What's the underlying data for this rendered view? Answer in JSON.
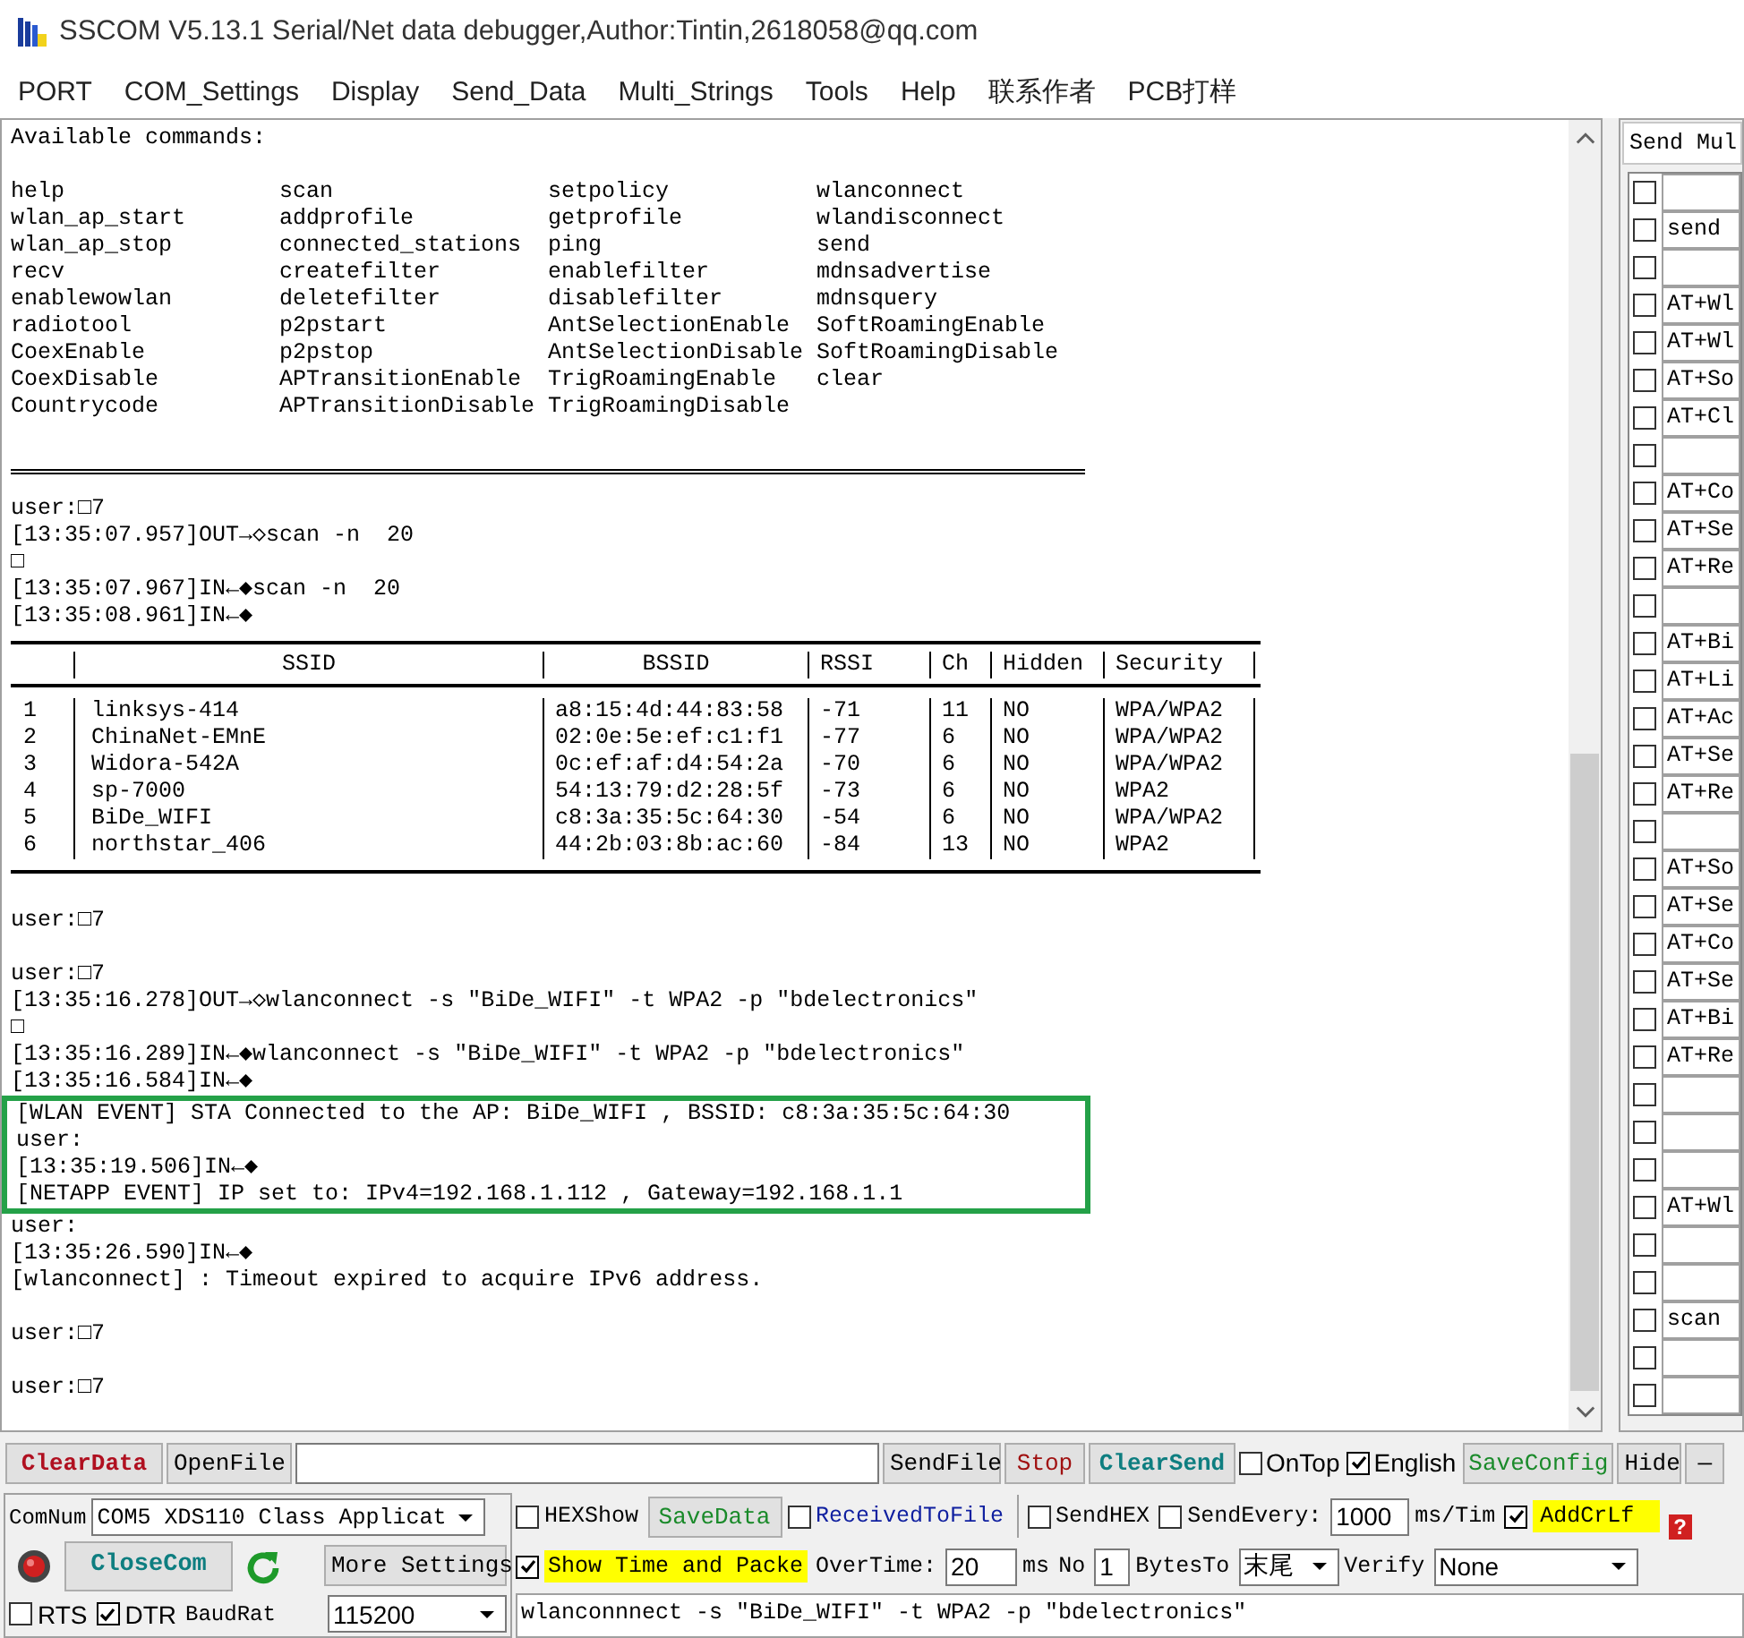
{
  "window": {
    "title": "SSCOM V5.13.1 Serial/Net data debugger,Author:Tintin,2618058@qq.com"
  },
  "menu": [
    "PORT",
    "COM_Settings",
    "Display",
    "Send_Data",
    "Multi_Strings",
    "Tools",
    "Help",
    "联系作者",
    "PCB打样"
  ],
  "terminal": {
    "blocks": [
      {
        "kind": "line",
        "text": "Available commands:"
      },
      {
        "kind": "blank"
      },
      {
        "kind": "commands",
        "rows": [
          [
            "help",
            "scan",
            "setpolicy",
            "wlanconnect"
          ],
          [
            "wlan_ap_start",
            "addprofile",
            "getprofile",
            "wlandisconnect"
          ],
          [
            "wlan_ap_stop",
            "connected_stations",
            "ping",
            "send"
          ],
          [
            "recv",
            "createfilter",
            "enablefilter",
            "mdnsadvertise"
          ],
          [
            "enablewowlan",
            "deletefilter",
            "disablefilter",
            "mdnsquery"
          ],
          [
            "radiotool",
            "p2pstart",
            "AntSelectionEnable",
            "SoftRoamingEnable"
          ],
          [
            "CoexEnable",
            "p2pstop",
            "AntSelectionDisable",
            "SoftRoamingDisable"
          ],
          [
            "CoexDisable",
            "APTransitionEnable",
            "TrigRoamingEnable",
            "clear"
          ],
          [
            "Countrycode",
            "APTransitionDisable",
            "TrigRoamingDisable"
          ]
        ]
      },
      {
        "kind": "blank"
      },
      {
        "kind": "rule"
      },
      {
        "kind": "blank"
      },
      {
        "kind": "line",
        "text": "user:□7"
      },
      {
        "kind": "line",
        "text": "[13:35:07.957]OUT→◇scan -n  20"
      },
      {
        "kind": "line",
        "text": "□"
      },
      {
        "kind": "line",
        "text": "[13:35:07.967]IN←◆scan -n  20"
      },
      {
        "kind": "line",
        "text": "[13:35:08.961]IN←◆"
      },
      {
        "kind": "table",
        "columns": [
          "SSID",
          "BSSID",
          "RSSI",
          "Ch",
          "Hidden",
          "Security"
        ],
        "rows": [
          {
            "number": "1",
            "cells": [
              "linksys-414",
              "a8:15:4d:44:83:58",
              "-71",
              "11",
              "NO",
              "WPA/WPA2"
            ]
          },
          {
            "number": "2",
            "cells": [
              "ChinaNet-EMnE",
              "02:0e:5e:ef:c1:f1",
              "-77",
              "6",
              "NO",
              "WPA/WPA2"
            ]
          },
          {
            "number": "3",
            "cells": [
              "Widora-542A",
              "0c:ef:af:d4:54:2a",
              "-70",
              "6",
              "NO",
              "WPA/WPA2"
            ]
          },
          {
            "number": "4",
            "cells": [
              "sp-7000",
              "54:13:79:d2:28:5f",
              "-73",
              "6",
              "NO",
              "WPA2"
            ]
          },
          {
            "number": "5",
            "cells": [
              "BiDe_WIFI",
              "c8:3a:35:5c:64:30",
              "-54",
              "6",
              "NO",
              "WPA/WPA2"
            ]
          },
          {
            "number": "6",
            "cells": [
              "northstar_406",
              "44:2b:03:8b:ac:60",
              "-84",
              "13",
              "NO",
              "WPA2"
            ]
          }
        ]
      },
      {
        "kind": "blank"
      },
      {
        "kind": "line",
        "text": "user:□7"
      },
      {
        "kind": "blank"
      },
      {
        "kind": "line",
        "text": "user:□7"
      },
      {
        "kind": "line",
        "text": "[13:35:16.278]OUT→◇wlanconnect -s \"BiDe_WIFI\" -t WPA2 -p \"bdelectronics\""
      },
      {
        "kind": "line",
        "text": "□"
      },
      {
        "kind": "line",
        "text": "[13:35:16.289]IN←◆wlanconnect -s \"BiDe_WIFI\" -t WPA2 -p \"bdelectronics\""
      },
      {
        "kind": "line",
        "text": "[13:35:16.584]IN←◆"
      },
      {
        "kind": "highlight",
        "lines": [
          "[WLAN EVENT] STA Connected to the AP: BiDe_WIFI , BSSID: c8:3a:35:5c:64:30",
          "user:",
          "[13:35:19.506]IN←◆",
          "[NETAPP EVENT] IP set to: IPv4=192.168.1.112 , Gateway=192.168.1.1"
        ]
      },
      {
        "kind": "line",
        "text": "user:"
      },
      {
        "kind": "line",
        "text": "[13:35:26.590]IN←◆"
      },
      {
        "kind": "line",
        "text": "[wlanconnect] : Timeout expired to acquire IPv6 address."
      },
      {
        "kind": "blank"
      },
      {
        "kind": "line",
        "text": "user:□7"
      },
      {
        "kind": "blank"
      },
      {
        "kind": "line",
        "text": "user:□7"
      }
    ]
  },
  "send_panel": {
    "title": "Send Mul",
    "items": [
      {
        "checked": false
      },
      {
        "checked": false,
        "text": "send"
      },
      {
        "checked": false
      },
      {
        "checked": false,
        "text": "AT+Wl"
      },
      {
        "checked": false,
        "text": "AT+Wl"
      },
      {
        "checked": false,
        "text": "AT+So"
      },
      {
        "checked": false,
        "text": "AT+Cl"
      },
      {
        "checked": false
      },
      {
        "checked": false,
        "text": "AT+Co"
      },
      {
        "checked": false,
        "text": "AT+Se"
      },
      {
        "checked": false,
        "text": "AT+Re"
      },
      {
        "checked": false
      },
      {
        "checked": false,
        "text": "AT+Bi"
      },
      {
        "checked": false,
        "text": "AT+Li"
      },
      {
        "checked": false,
        "text": "AT+Ac"
      },
      {
        "checked": false,
        "text": "AT+Se"
      },
      {
        "checked": false,
        "text": "AT+Re"
      },
      {
        "checked": false
      },
      {
        "checked": false,
        "text": "AT+So"
      },
      {
        "checked": false,
        "text": "AT+Se"
      },
      {
        "checked": false,
        "text": "AT+Co"
      },
      {
        "checked": false,
        "text": "AT+Se"
      },
      {
        "checked": false,
        "text": "AT+Bi"
      },
      {
        "checked": false,
        "text": "AT+Re"
      },
      {
        "checked": false
      },
      {
        "checked": false
      },
      {
        "checked": false
      },
      {
        "checked": false,
        "text": "AT+Wl"
      },
      {
        "checked": false
      },
      {
        "checked": false
      },
      {
        "checked": false,
        "text": "scan"
      },
      {
        "checked": false
      },
      {
        "checked": false
      }
    ]
  },
  "toolbar": {
    "clear_data": "ClearData",
    "open_file": "OpenFile",
    "send_file": "SendFile",
    "stop": "Stop",
    "clear_send": "ClearSend",
    "on_top": {
      "label": "OnTop",
      "checked": false
    },
    "english": {
      "label": "English",
      "checked": true
    },
    "save_config": "SaveConfig",
    "hide": "Hide",
    "minimize": "—"
  },
  "port_panel": {
    "com_label": "ComNum",
    "com_value": "COM5 XDS110 Class Applicat",
    "close_button": "CloseCom",
    "more_settings": "More Settings",
    "rts": {
      "label": "RTS",
      "checked": false
    },
    "dtr": {
      "label": "DTR",
      "checked": true
    },
    "baud_label": "BaudRat",
    "baud_value": "115200"
  },
  "receive_options": {
    "hex_show": {
      "label": "HEXShow",
      "checked": false
    },
    "save_data": "SaveData",
    "received_to_file": {
      "label": "ReceivedToFile",
      "checked": false
    },
    "show_time": {
      "label": "Show Time and Packe",
      "checked": true
    },
    "overtime_label": "OverTime:",
    "overtime_value": "20",
    "overtime_unit": "ms"
  },
  "send_options": {
    "send_hex": {
      "label": "SendHEX",
      "checked": false
    },
    "send_every": {
      "label": "SendEvery:",
      "checked": false
    },
    "interval_value": "1000",
    "interval_unit": "ms/Tim",
    "add_crlf": {
      "label": "AddCrLf",
      "checked": true
    },
    "help": "?",
    "no_label": "No",
    "no_value": "1",
    "bytes_to_label": "BytesTo",
    "bytes_to_value": "末尾",
    "verify_label": "Verify",
    "verify_value": "None"
  },
  "send_text": "wlanconnnect -s \"BiDe_WIFI\" -t WPA2 -p \"bdelectronics\""
}
